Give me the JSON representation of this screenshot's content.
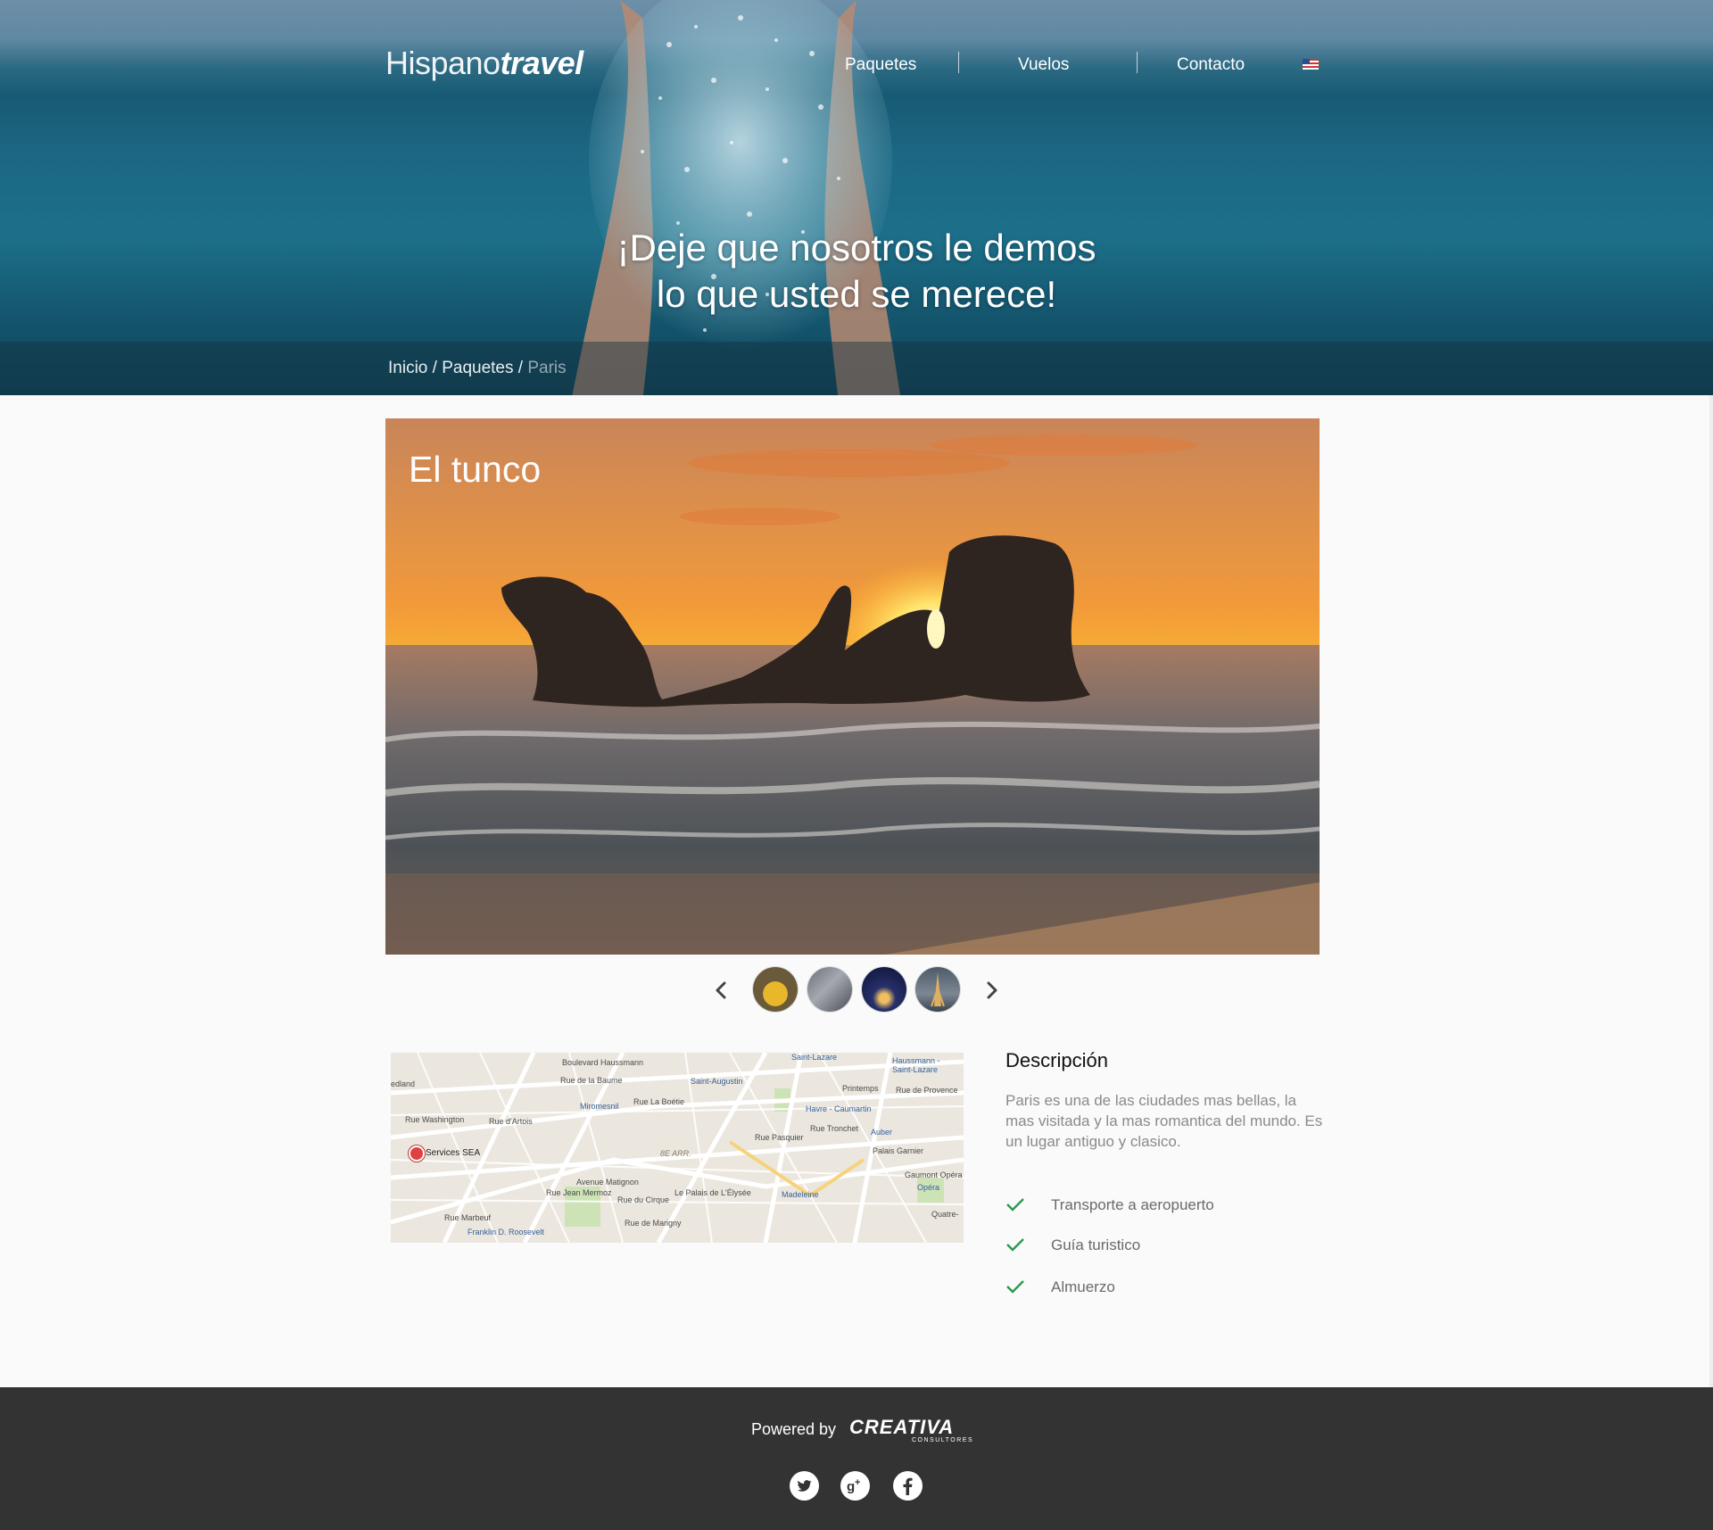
{
  "header": {
    "logo_regular": "Hispano",
    "logo_bold": "travel",
    "nav": [
      "Paquetes",
      "Vuelos",
      "Contacto"
    ],
    "language_flag": "us-flag-icon",
    "headline_line1": "¡Deje que nosotros le demos",
    "headline_line2": "lo que usted se merece!"
  },
  "breadcrumb": {
    "items": [
      "Inicio",
      "Paquetes",
      "Paris"
    ],
    "separator": " / "
  },
  "gallery": {
    "title": "El tunco",
    "prev_icon": "chevron-left-icon",
    "next_icon": "chevron-right-icon",
    "thumbnail_count": 4
  },
  "map": {
    "marker_label": "Services SEA",
    "labels": [
      "Boulevard Haussmann",
      "Saint-Lazare",
      "Haussmann - Saint-Lazare",
      "Rue de la Baume",
      "edland",
      "Saint-Augustin",
      "Printemps",
      "Rue de Provence",
      "Rue La Boétie",
      "Miromesnil",
      "Havre - Caumartin",
      "Rue Washington",
      "Rue d'Artois",
      "Auber",
      "Palais Garnier",
      "8E ARR.",
      "Rue Pasquier",
      "Rue Tronchet",
      "Gaumont Opéra",
      "Opéra",
      "Avenue Matignon",
      "Rue Jean Mermoz",
      "Rue du Cirque",
      "Le Palais de L'Élysée",
      "Madeleine",
      "Rue de Marigny",
      "Rue Marbeuf",
      "Franklin D. Roosevelt",
      "Quatre-"
    ]
  },
  "description": {
    "title": "Descripción",
    "text": "Paris es una de las ciudades mas bellas, la mas visitada y la mas romantica del mundo. Es un lugar antiguo y clasico.",
    "features": [
      "Transporte a aeropuerto",
      "Guía turistico",
      "Almuerzo"
    ],
    "check_color": "#2e9b4f"
  },
  "footer": {
    "powered_by": "Powered by",
    "brand": "CREATIVA",
    "brand_sub": "CONSULTORES",
    "social_icons": [
      "twitter-icon",
      "google-plus-icon",
      "facebook-icon"
    ]
  },
  "colors": {
    "footer_bg": "#333333",
    "page_bg": "#fafafa",
    "hero_sea": "#1c6884"
  }
}
